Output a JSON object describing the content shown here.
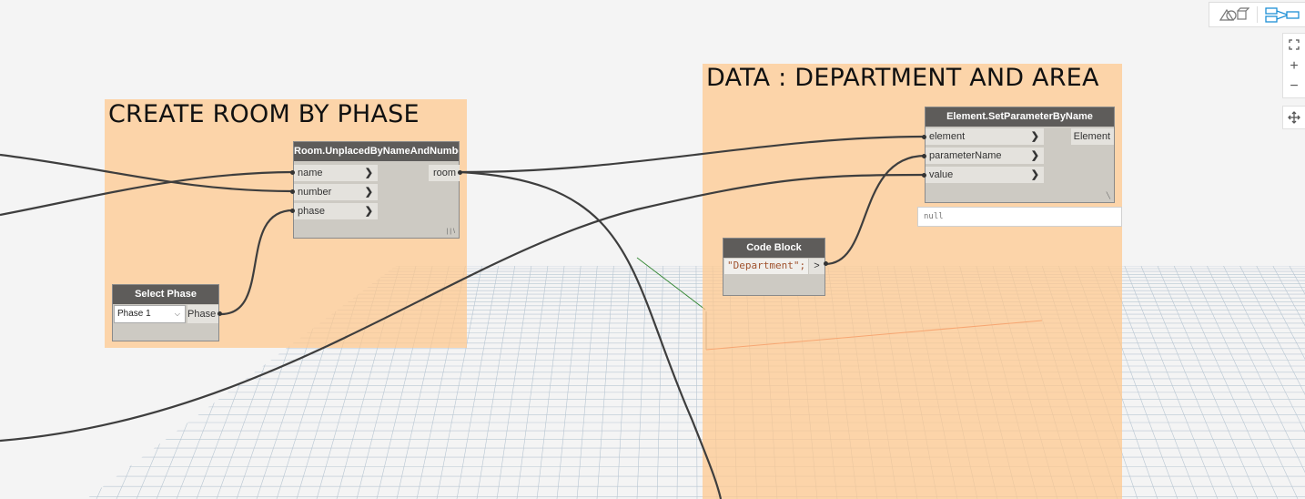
{
  "groups": {
    "room_group": {
      "title": "CREATE ROOM BY PHASE"
    },
    "data_group": {
      "title": "DATA : DEPARTMENT AND AREA"
    }
  },
  "nodes": {
    "room_node": {
      "title": "Room.UnplacedByNameAndNumber",
      "inputs": [
        "name",
        "number",
        "phase"
      ],
      "output": "room",
      "lacing": "| | \\"
    },
    "select_phase": {
      "title": "Select Phase",
      "selected": "Phase 1",
      "output": "Phase"
    },
    "set_param": {
      "title": "Element.SetParameterByName",
      "inputs": [
        "element",
        "parameterName",
        "value"
      ],
      "output": "Element",
      "preview": "null"
    },
    "code_block": {
      "title": "Code Block",
      "code": "\"Department\";",
      "output": ">"
    }
  },
  "icons": {
    "geometry_view": "geometry-view-icon",
    "graph_view": "graph-view-icon",
    "fit": "fit-view-icon",
    "zoom_in": "zoom-in-icon",
    "zoom_out": "zoom-out-icon",
    "pan": "pan-icon"
  },
  "colors": {
    "group": "#FFC88C",
    "node_header": "#5E5C5A",
    "node_body": "#CDCAC3",
    "wire": "#3E3E3E",
    "accent": "#1E90D6"
  }
}
